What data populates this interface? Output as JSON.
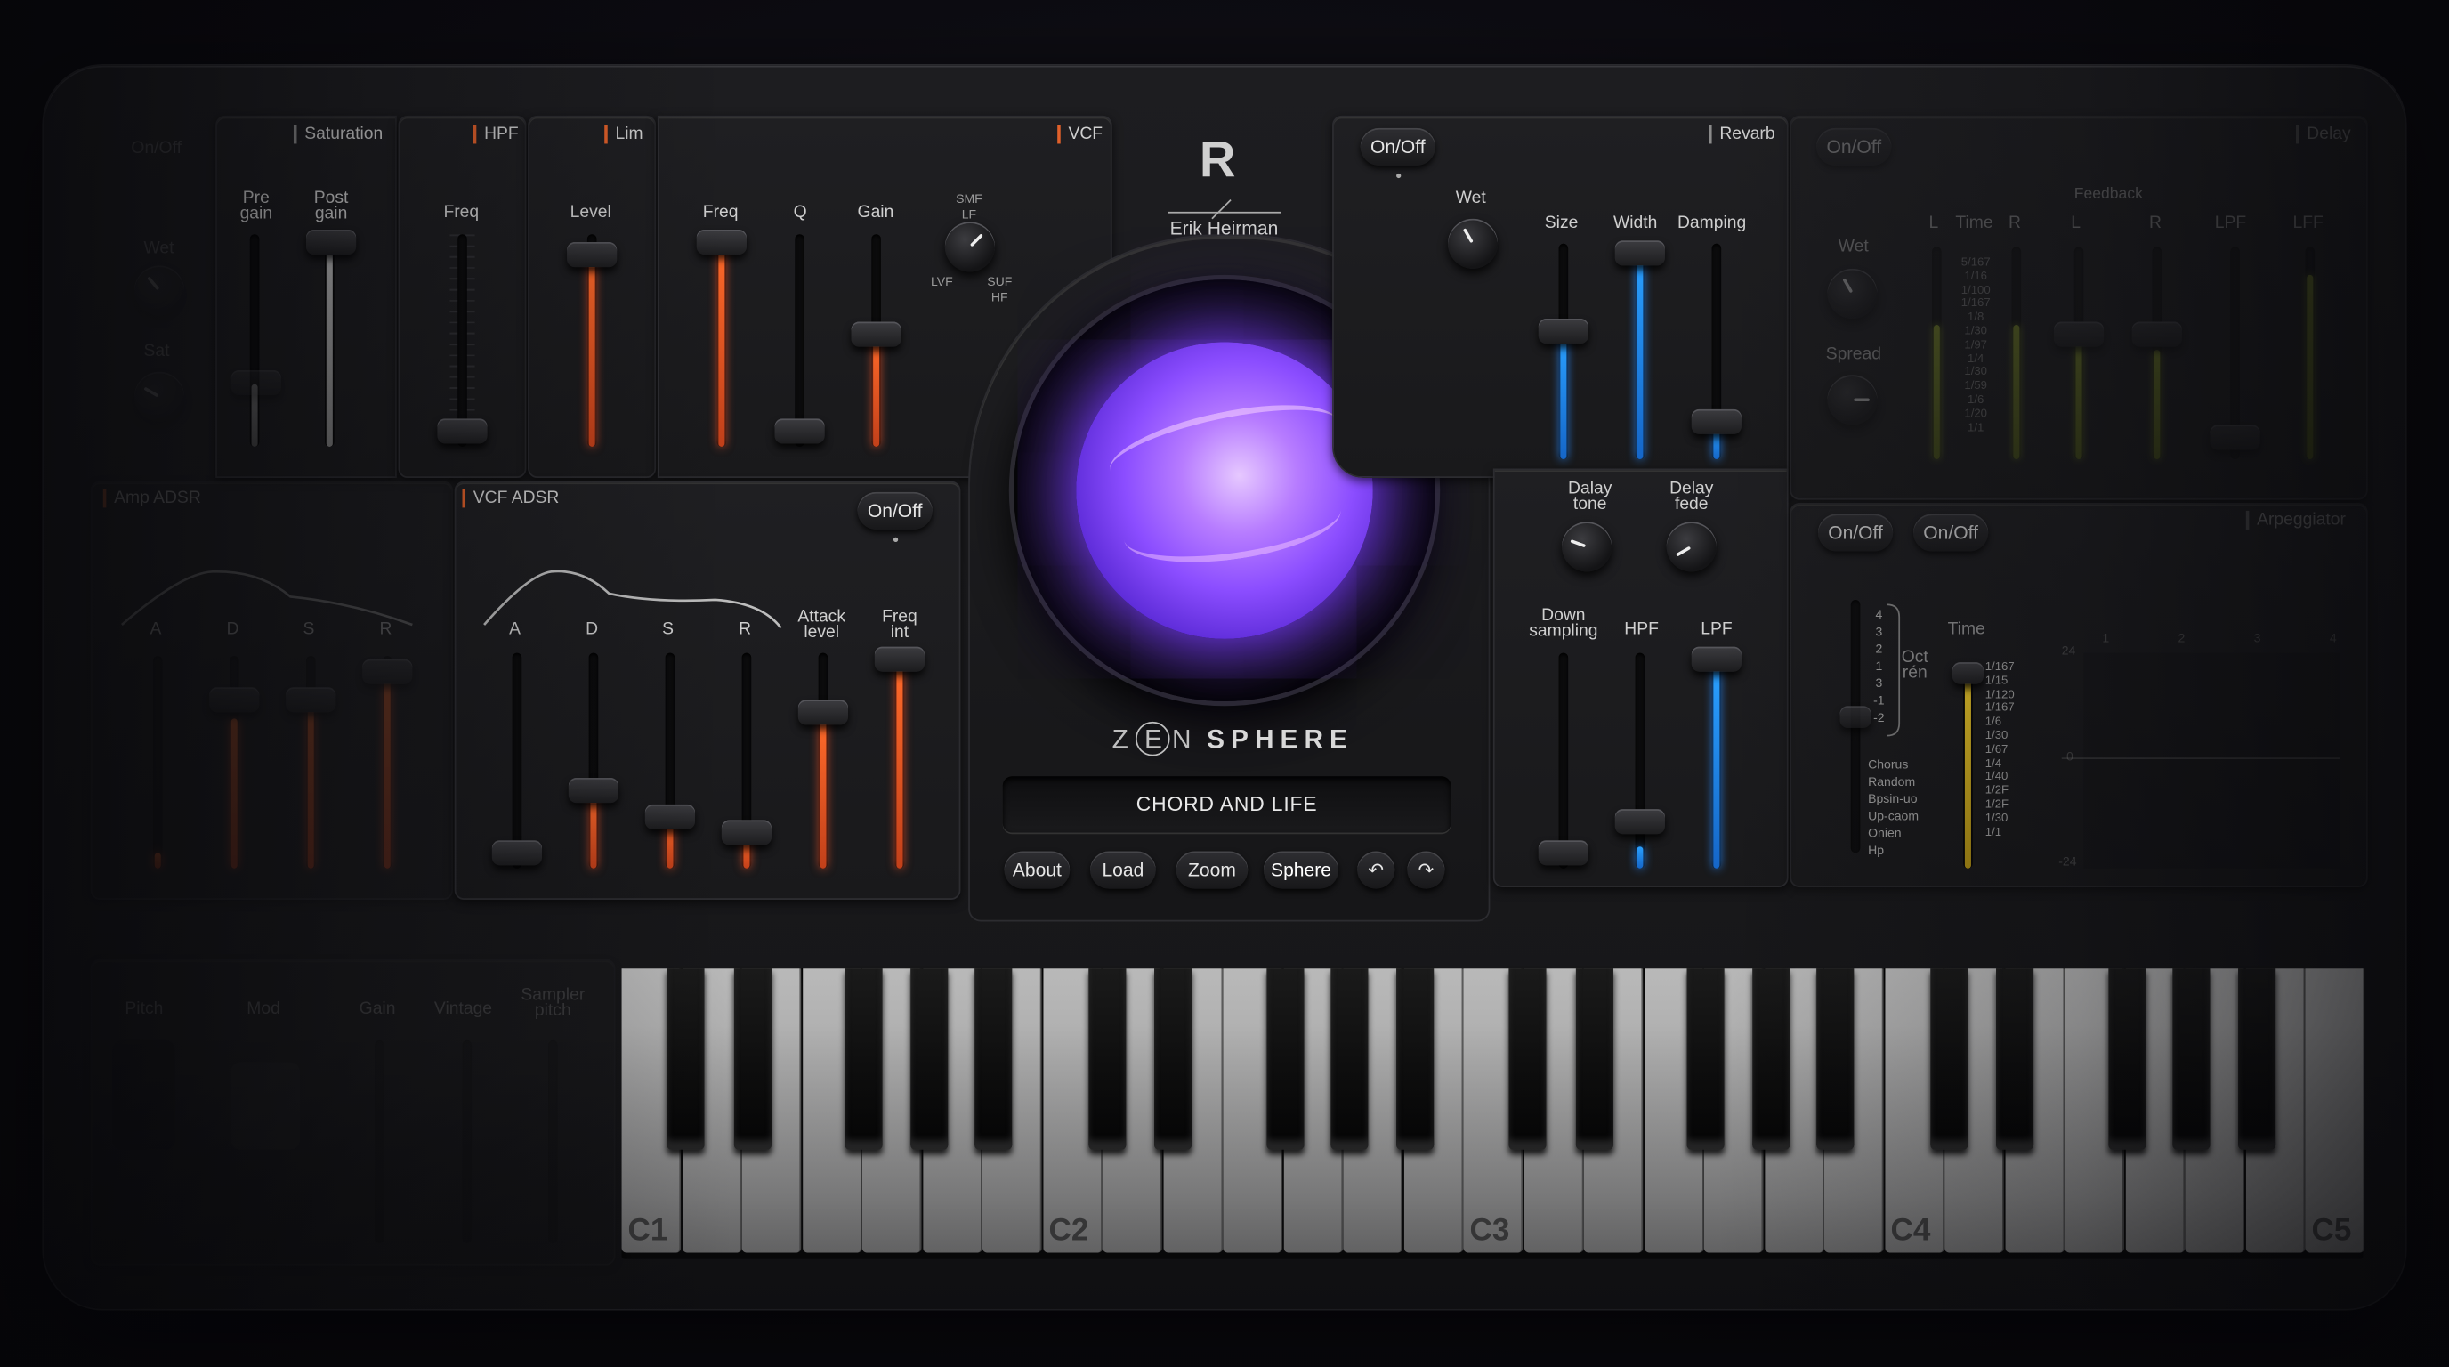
{
  "app": {
    "logo_letter": "R",
    "author": "Erik Heirman",
    "brand_prefix": "Z",
    "brand_e": "E",
    "brand_n": "N",
    "brand_suffix": "SPHERE",
    "preset_name": "CHORD AND LIFE"
  },
  "buttons": {
    "about": "About",
    "load": "Load",
    "zoom": "Zoom",
    "sphere": "Sphere",
    "onoff": "On/Off"
  },
  "drive": {
    "onoff": "On/Off",
    "wet": "Wet",
    "sat": "Sat"
  },
  "saturation": {
    "title": "Saturation",
    "pre": "Pre\ngain",
    "post": "Post\ngain"
  },
  "hpf": {
    "title": "HPF",
    "freq": "Freq"
  },
  "lim": {
    "title": "Lim",
    "level": "Level"
  },
  "vcf": {
    "title": "VCF",
    "freq": "Freq",
    "q": "Q",
    "gain": "Gain",
    "smf": "SMF\nLF",
    "lvf": "LVF",
    "suf": "SUF\nHF"
  },
  "amp_adsr": {
    "title": "Amp ADSR",
    "a": "A",
    "d": "D",
    "s": "S",
    "r": "R"
  },
  "vcf_adsr": {
    "title": "VCF ADSR",
    "a": "A",
    "d": "D",
    "s": "S",
    "r": "R",
    "attack": "Attack\nlevel",
    "freq": "Freq\nint"
  },
  "reverb": {
    "title": "Revarb",
    "wet": "Wet",
    "size": "Size",
    "width": "Width",
    "damping": "Damping",
    "delay_tone": "Dalay\ntone",
    "delay_fede": "Delay\nfede",
    "down": "Down\nsampling",
    "hpf": "HPF",
    "lpf": "LPF"
  },
  "delay": {
    "title": "Delay",
    "wet": "Wet",
    "spread": "Spread",
    "l": "L",
    "time": "Time",
    "r": "R",
    "feedback": "Feedback",
    "fl": "L",
    "fr": "R",
    "lpf1": "LPF",
    "lpf2": "LFF",
    "time_values": [
      "5/167",
      "1/16",
      "1/100",
      "1/167",
      "1/8",
      "1/30",
      "1/97",
      "1/4",
      "1/30",
      "1/59",
      "1/6",
      "1/20",
      "1/1"
    ]
  },
  "arp": {
    "title": "Arpeggiator",
    "oct": "Oct\nrén",
    "time": "Time",
    "oct_values": [
      "4",
      "3",
      "2",
      "1",
      "3",
      "-1",
      "-2"
    ],
    "modes": [
      "Chorus",
      "Random",
      "Bpsin-uo",
      "Up-caom",
      "Onien",
      "Hp"
    ],
    "time_values": [
      "1/167",
      "1/15",
      "1/120",
      "1/167",
      "1/6",
      "1/30",
      "1/67",
      "1/4",
      "1/40",
      "1/2F",
      "1/2F",
      "1/30",
      "1/1"
    ],
    "grid_cols": [
      "1",
      "2",
      "3",
      "4"
    ],
    "y_top": "24",
    "y_mid": "0",
    "y_bot": "-24"
  },
  "bottom": {
    "pitch": "Pitch",
    "mod": "Mod",
    "gain": "Gain",
    "vintage": "Vintage",
    "sampler": "Sampler\npitch"
  },
  "keyboard": {
    "octaves": [
      "C1",
      "C2",
      "C3",
      "C4",
      "C5"
    ]
  },
  "colors": {
    "accent_orange": "#e0602a",
    "accent_blue": "#2a8cff",
    "accent_purple": "#8b4dff",
    "accent_lime": "#a9c02a"
  }
}
